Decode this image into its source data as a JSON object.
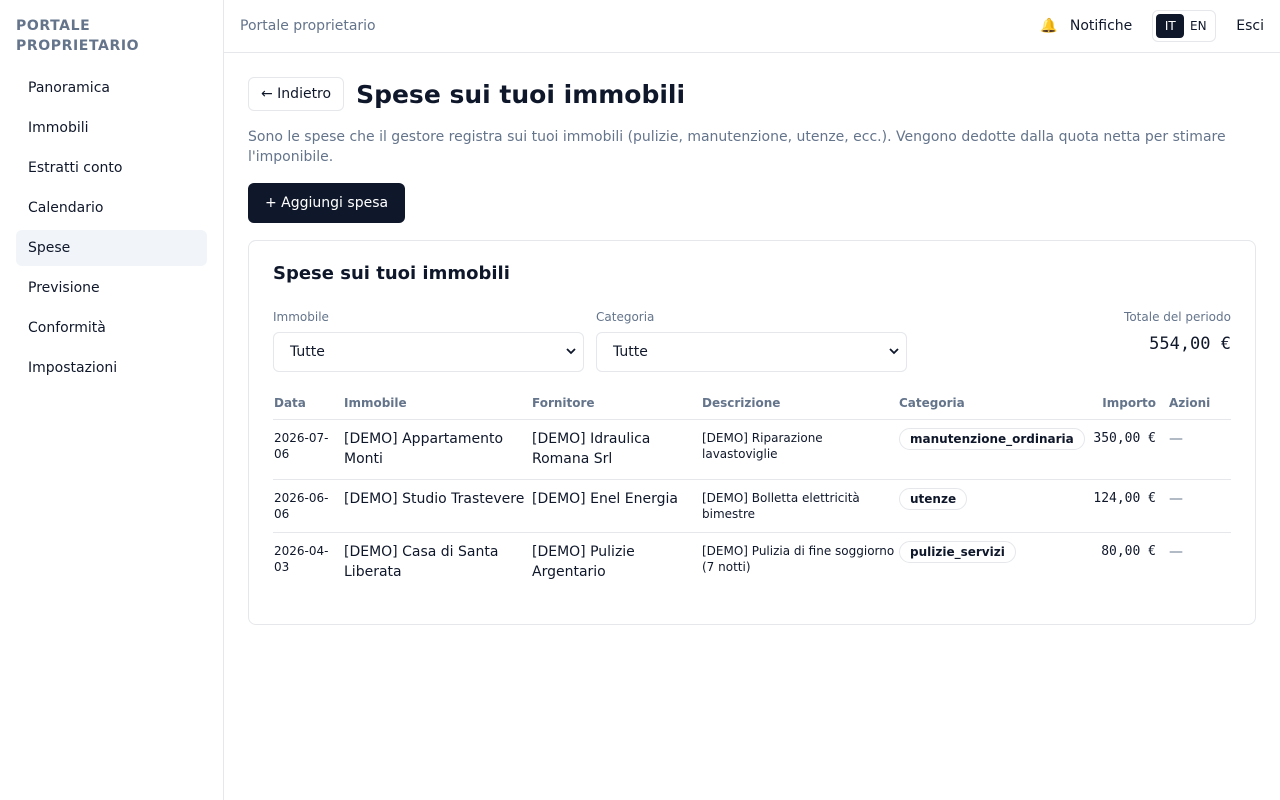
{
  "sidebar": {
    "brand": "PORTALE\nPROPRIETARIO",
    "items": [
      {
        "label": "Panoramica"
      },
      {
        "label": "Immobili"
      },
      {
        "label": "Estratti conto"
      },
      {
        "label": "Calendario"
      },
      {
        "label": "Spese",
        "active": true
      },
      {
        "label": "Previsione"
      },
      {
        "label": "Conformità"
      },
      {
        "label": "Impostazioni"
      }
    ]
  },
  "topbar": {
    "title": "Portale proprietario",
    "notifications_label": "Notifiche",
    "bell_icon": "bell-icon",
    "lang_it": "IT",
    "lang_en": "EN",
    "logout_label": "Esci"
  },
  "page": {
    "back_label": "← Indietro",
    "title": "Spese sui tuoi immobili",
    "intro": "Sono le spese che il gestore registra sui tuoi immobili (pulizie, manutenzione, utenze, ecc.). Vengono dedotte dalla quota netta per stimare l'imponibile.",
    "add_label": "+ Aggiungi spesa"
  },
  "card": {
    "title": "Spese sui tuoi immobili",
    "filter_property_label": "Immobile",
    "filter_property_value": "Tutte",
    "filter_category_label": "Categoria",
    "filter_category_value": "Tutte",
    "total_label": "Totale del periodo",
    "total_value": "554,00 €"
  },
  "table": {
    "headers": {
      "date": "Data",
      "property": "Immobile",
      "supplier": "Fornitore",
      "description": "Descrizione",
      "category": "Categoria",
      "amount": "Importo",
      "actions": "Azioni"
    },
    "rows": [
      {
        "date": "2026-07-06",
        "property": "[DEMO] Appartamento Monti",
        "supplier": "[DEMO] Idraulica Romana Srl",
        "description": "[DEMO] Riparazione lavastoviglie",
        "category": "manutenzione_ordinaria",
        "amount": "350,00 €",
        "actions": "—"
      },
      {
        "date": "2026-06-06",
        "property": "[DEMO] Studio Trastevere",
        "supplier": "[DEMO] Enel Energia",
        "description": "[DEMO] Bolletta elettricità bimestre",
        "category": "utenze",
        "amount": "124,00 €",
        "actions": "—"
      },
      {
        "date": "2026-04-03",
        "property": "[DEMO] Casa di Santa Liberata",
        "supplier": "[DEMO] Pulizie Argentario",
        "description": "[DEMO] Pulizia di fine soggiorno (7 notti)",
        "category": "pulizie_servizi",
        "amount": "80,00 €",
        "actions": "—"
      }
    ]
  }
}
